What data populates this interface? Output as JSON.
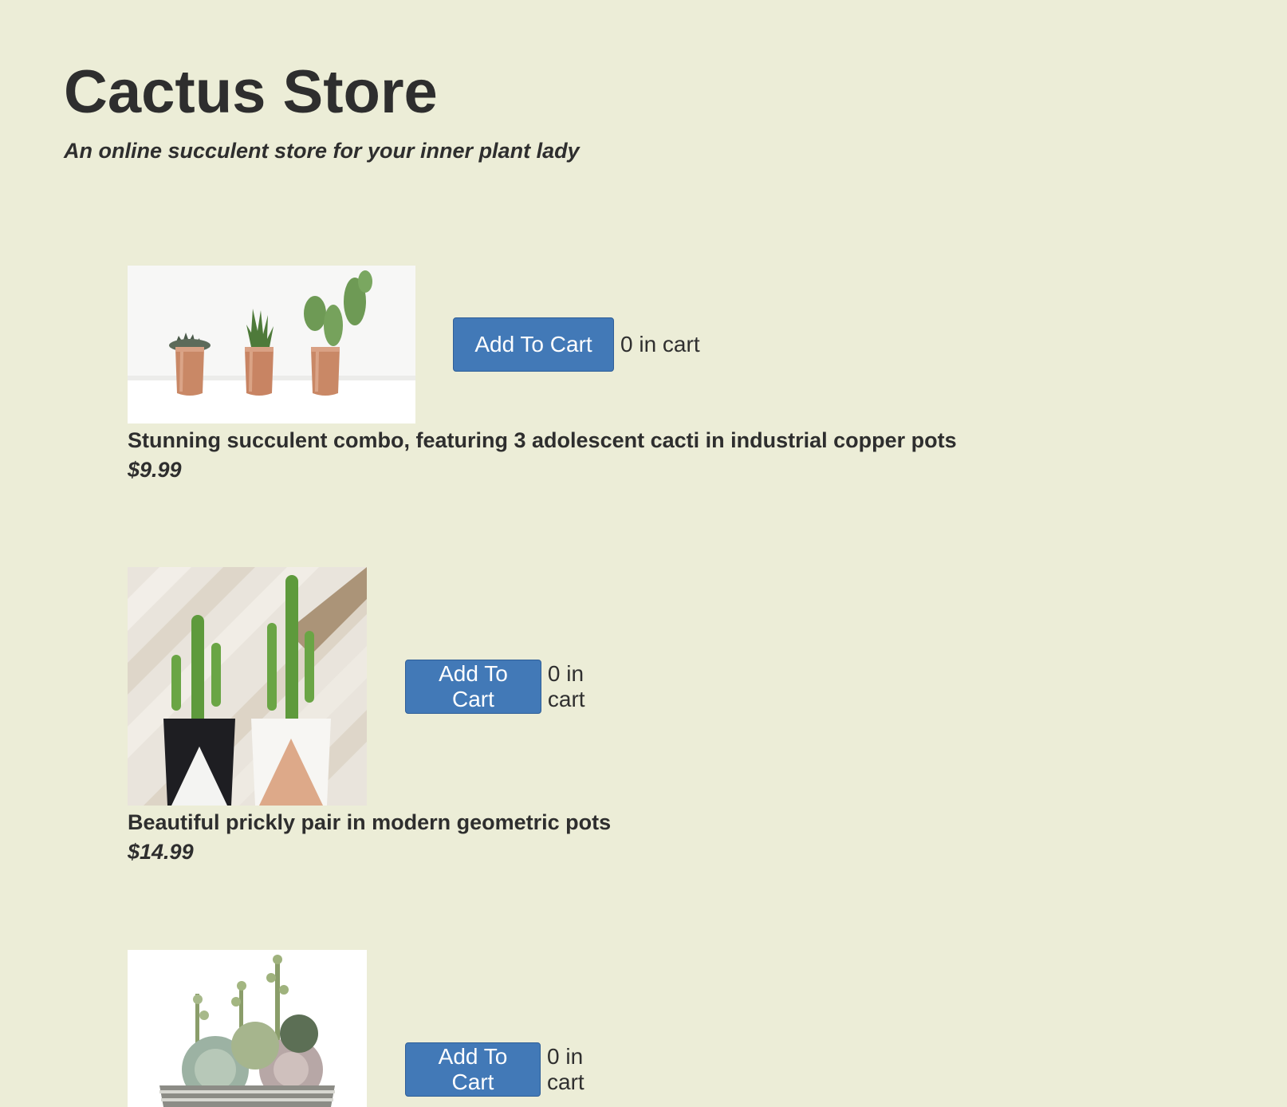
{
  "header": {
    "title": "Cactus Store",
    "tagline": "An online succulent store for your inner plant lady"
  },
  "products": [
    {
      "image": "three-cacti-copper-pots-photo",
      "button_label": "Add To Cart",
      "cart_count": "0 in cart",
      "description": "Stunning succulent combo, featuring 3 adolescent cacti in industrial copper pots",
      "price": "$9.99"
    },
    {
      "image": "two-cacti-geometric-pots-photo",
      "button_label": "Add To Cart",
      "cart_count": "0 in cart",
      "description": "Beautiful prickly pair in modern geometric pots",
      "price": "$14.99"
    },
    {
      "image": "succulent-bowl-arrangement-photo",
      "button_label": "Add To Cart",
      "cart_count": "0 in cart"
    }
  ],
  "colors": {
    "background": "#ecedd7",
    "button": "#4279b7",
    "text": "#2e2e2e"
  }
}
